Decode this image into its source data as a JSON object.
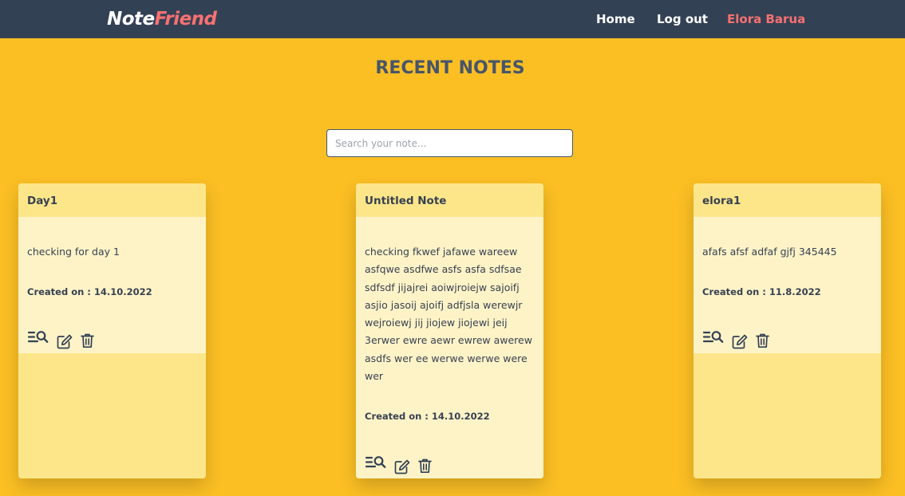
{
  "navbar": {
    "brand_part1": "Note",
    "brand_part2": "Friend",
    "home_label": "Home",
    "logout_label": "Log out",
    "user_name": "Elora Barua"
  },
  "page": {
    "title": "RECENT NOTES"
  },
  "search": {
    "placeholder": "Search your note...",
    "value": ""
  },
  "notes": [
    {
      "title": "Day1",
      "content": "checking for day 1",
      "created_label": "Created on : ",
      "created_date": "14.10.2022"
    },
    {
      "title": "Untitled Note",
      "content": "checking fkwef jafawe wareew asfqwe asdfwe asfs asfa sdfsae sdfsdf jijajrei aoiwjroiejw sajoifj asjio jasoij ajoifj adfjsla werewjr wejroiewj jij jiojew jiojewi jeij 3erwer ewre aewr ewrew awerew asdfs wer ee werwe werwe were wer",
      "created_label": "Created on : ",
      "created_date": "14.10.2022"
    },
    {
      "title": "elora1",
      "content": "afafs afsf adfaf gjfj 345445",
      "created_label": "Created on : ",
      "created_date": "11.8.2022"
    }
  ],
  "icons": {
    "view": "view-note-icon",
    "edit": "edit-icon",
    "delete": "trash-icon"
  },
  "colors": {
    "background": "#fbbf24",
    "navbar": "#334155",
    "brand_accent": "#f87171",
    "card_header": "#fde68a",
    "card_body": "#fef3c7",
    "text": "#374151"
  }
}
